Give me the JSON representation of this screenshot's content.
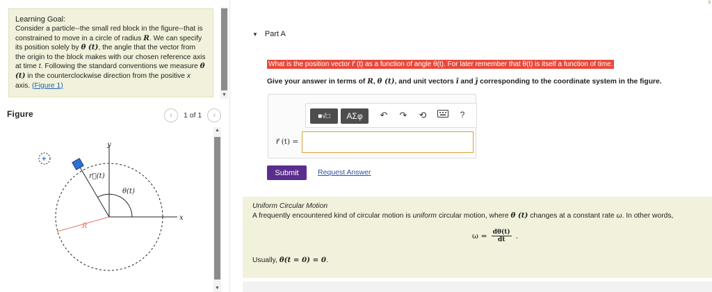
{
  "learning_goal": {
    "title": "Learning Goal:",
    "text_parts": [
      "Consider a particle--the small red block in the figure--that is constrained to move in a circle of radius ",
      "R",
      ". We can specify its position solely by ",
      "θ (t)",
      ", the angle that the vector from the origin to the block makes with our chosen reference axis at time ",
      "t",
      ". Following the standard conventions we measure ",
      "θ (t)",
      " in the counterclockwise direction from the positive ",
      "x",
      " axis. "
    ],
    "figure_link": "(Figure 1)"
  },
  "figure": {
    "label": "Figure",
    "pager_text": "1 of 1",
    "prev_icon": "chevron-left-icon",
    "next_icon": "chevron-right-icon",
    "labels": {
      "y": "y",
      "x": "x",
      "r": "r⃗(t)",
      "theta": "θ(t)",
      "R": "R",
      "rotation": "+"
    },
    "colors": {
      "block": "#2f6fd6",
      "radius": "#e8705a",
      "axis": "#222222",
      "circle": "#222222"
    }
  },
  "part": {
    "label": "Part A",
    "collapse_icon": "triangle-down-icon",
    "question": "What is the position vector r⃗ (t) as a function of angle θ(t). For later remember that θ(t) is itself a function of time.",
    "highlight_color": "#e8493c",
    "instruction_parts": [
      "Give your answer in terms of ",
      "R",
      ", ",
      "θ (t)",
      ", and unit vectors ",
      "î",
      " and ",
      "ĵ",
      " corresponding to the coordinate system in the figure."
    ],
    "toolbar": {
      "templates_label": "■√□",
      "symbols_label": "ΑΣφ",
      "undo_icon": "undo-icon",
      "redo_icon": "redo-icon",
      "reset_icon": "reset-icon",
      "keyboard_icon": "keyboard-icon",
      "help_label": "?"
    },
    "answer_label": "r⃗ (t) =",
    "answer_value": "",
    "submit_label": "Submit",
    "request_label": "Request Answer",
    "submit_color": "#5b2d8e"
  },
  "info": {
    "title": "Uniform Circular Motion",
    "body_parts": [
      "A frequently encountered kind of circular motion is ",
      "uniform",
      " circular motion, where ",
      "θ (t)",
      " changes at a constant rate ",
      "ω",
      ". In other words,"
    ],
    "formula_lhs": "ω =",
    "formula_num": "dθ(t)",
    "formula_den": "dt",
    "formula_tail": ".",
    "usually_prefix": "Usually, ",
    "usually_expr": "θ(t = 0) = 0",
    "usually_tail": "."
  }
}
